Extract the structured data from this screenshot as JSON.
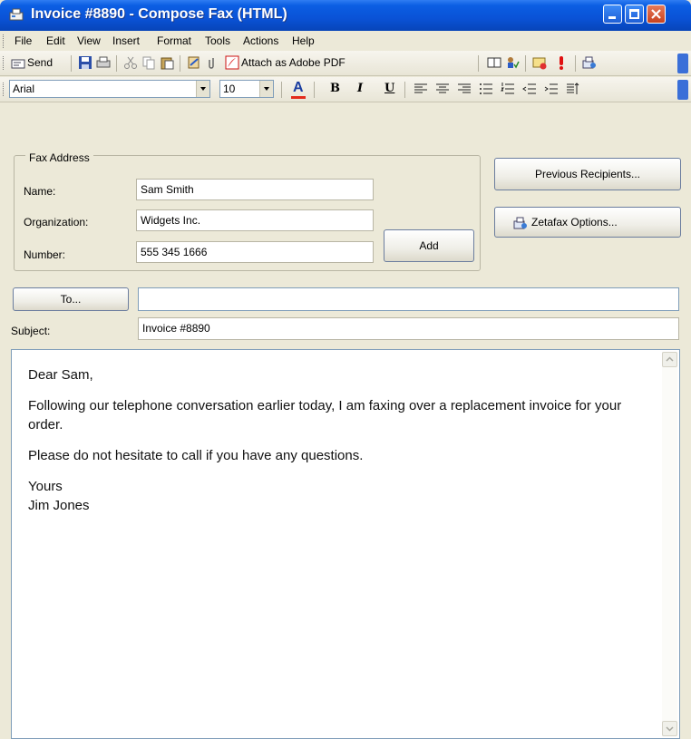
{
  "window": {
    "title": "Invoice #8890 - Compose Fax (HTML)"
  },
  "menu": [
    "File",
    "Edit",
    "View",
    "Insert",
    "Format",
    "Tools",
    "Actions",
    "Help"
  ],
  "toolbar": {
    "send_label": "Send",
    "attach_pdf_label": "Attach as Adobe PDF"
  },
  "format_bar": {
    "font": "Arial",
    "size": "10",
    "bold": "B",
    "italic": "I",
    "underline": "U"
  },
  "fax_address": {
    "group_label": "Fax Address",
    "name_label": "Name:",
    "name_value": "Sam Smith",
    "org_label": "Organization:",
    "org_value": "Widgets Inc.",
    "number_label": "Number:",
    "number_value": "555 345 1666",
    "add_label": "Add"
  },
  "buttons": {
    "previous_recipients": "Previous Recipients...",
    "zetafax_options": "Zetafax Options..."
  },
  "recipient": {
    "to_label": "To...",
    "to_value": "",
    "subject_label": "Subject:",
    "subject_value": "Invoice #8890"
  },
  "message": {
    "greeting": "Dear Sam,",
    "para1": "Following our telephone conversation earlier today, I am faxing over a replacement invoice for your order.",
    "para2": "Please do not hesitate to call if you have any questions.",
    "closing": "Yours",
    "signature": "Jim Jones"
  }
}
